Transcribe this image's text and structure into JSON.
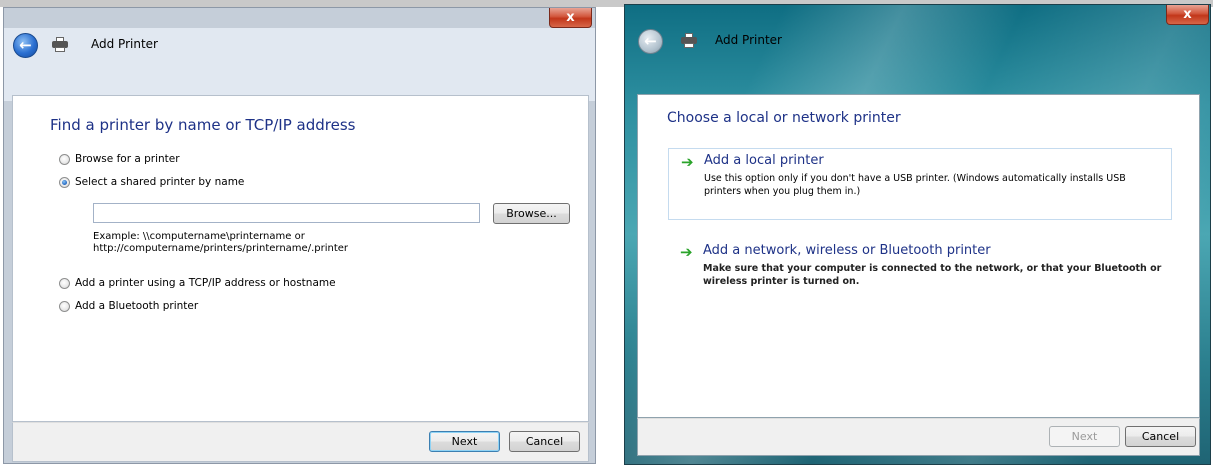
{
  "dialog_left": {
    "close_glyph": "x",
    "back_glyph": "←",
    "title": "Add Printer",
    "heading": "Find a printer by name or TCP/IP address",
    "options": [
      {
        "label": "Browse for a printer",
        "checked": false
      },
      {
        "label": "Select a shared printer by name",
        "checked": true
      },
      {
        "label": "Add a printer using a TCP/IP address or hostname",
        "checked": false
      },
      {
        "label": "Add a Bluetooth printer",
        "checked": false
      }
    ],
    "printer_name_input": {
      "value": "",
      "placeholder": ""
    },
    "browse_button": "Browse...",
    "example_line1": "Example: \\\\computername\\printername or",
    "example_line2": "http://computername/printers/printername/.printer",
    "next_button": "Next",
    "cancel_button": "Cancel"
  },
  "dialog_right": {
    "close_glyph": "x",
    "back_glyph": "←",
    "title": "Add Printer",
    "heading": "Choose a local or network printer",
    "choices": [
      {
        "arrow": "➔",
        "title": "Add a local printer",
        "description": "Use this option only if you don't have a USB printer. (Windows automatically installs USB printers when you plug them in.)"
      },
      {
        "arrow": "➔",
        "title": "Add a network, wireless or Bluetooth printer",
        "description": "Make sure that your computer is connected to the network, or that your Bluetooth or wireless printer is turned on."
      }
    ],
    "next_button": "Next",
    "cancel_button": "Cancel"
  },
  "colors": {
    "heading_blue": "#1e3287",
    "arrow_green": "#2aa32a",
    "close_red": "#c2361a"
  },
  "icons": [
    "back-arrow-icon",
    "printer-icon",
    "close-icon",
    "green-arrow-icon"
  ]
}
